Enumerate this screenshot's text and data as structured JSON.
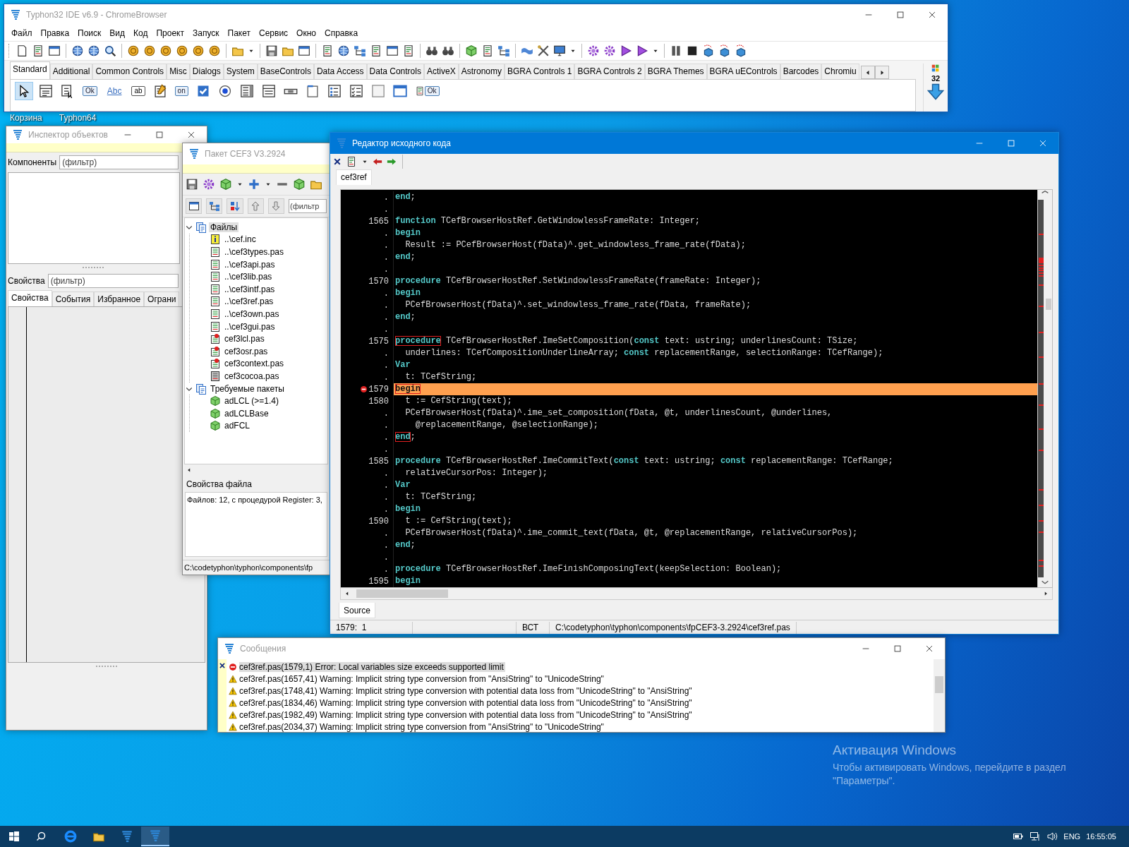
{
  "desktop": {
    "icons": [
      {
        "label": "Корзина"
      },
      {
        "label": "Typhon64"
      }
    ],
    "activation": {
      "title": "Активация Windows",
      "text": "Чтобы активировать Windows, перейдите в раздел \"Параметры\"."
    }
  },
  "main_window": {
    "title": "Typhon32 IDE v6.9 - ChromeBrowser",
    "menu": [
      "Файл",
      "Правка",
      "Поиск",
      "Вид",
      "Код",
      "Проект",
      "Запуск",
      "Пакет",
      "Сервис",
      "Окно",
      "Справка"
    ],
    "palette_tabs": [
      {
        "label": "Standard",
        "selected": true
      },
      {
        "label": "Additional",
        "selected": false
      },
      {
        "label": "Common Controls",
        "selected": false
      },
      {
        "label": "Misc",
        "selected": false
      },
      {
        "label": "Dialogs",
        "selected": false
      },
      {
        "label": "System",
        "selected": false
      },
      {
        "label": "BaseControls",
        "selected": false
      },
      {
        "label": "Data Access",
        "selected": false
      },
      {
        "label": "Data Controls",
        "selected": false
      },
      {
        "label": "ActiveX",
        "selected": false
      },
      {
        "label": "Astronomy",
        "selected": false
      },
      {
        "label": "BGRA Controls 1",
        "selected": false
      },
      {
        "label": "BGRA Controls 2",
        "selected": false
      },
      {
        "label": "BGRA Themes",
        "selected": false
      },
      {
        "label": "BGRA uEControls",
        "selected": false
      },
      {
        "label": "Barcodes",
        "selected": false
      },
      {
        "label": "Chromiu",
        "selected": false
      }
    ],
    "palette": [
      {
        "kind": "pointer",
        "selected": true
      },
      {
        "kind": "menu",
        "selected": false
      },
      {
        "kind": "popup",
        "selected": false
      },
      {
        "kind": "button",
        "label": "Ok",
        "selected": false
      },
      {
        "kind": "label",
        "label": "Abc",
        "selected": false
      },
      {
        "kind": "edit",
        "label": "ab",
        "selected": false
      },
      {
        "kind": "memo",
        "selected": false
      },
      {
        "kind": "toggle",
        "label": "on",
        "selected": false
      },
      {
        "kind": "checkbox",
        "selected": false
      },
      {
        "kind": "radio",
        "selected": false
      },
      {
        "kind": "listbox",
        "selected": false
      },
      {
        "kind": "combo",
        "selected": false
      },
      {
        "kind": "scrollbar",
        "selected": false
      },
      {
        "kind": "groupbox",
        "selected": false
      },
      {
        "kind": "radiogroup",
        "selected": false
      },
      {
        "kind": "checkgroup",
        "selected": false
      },
      {
        "kind": "panel",
        "selected": false
      },
      {
        "kind": "frame",
        "selected": false
      },
      {
        "kind": "actionlist",
        "label": "Ok",
        "selected": false
      }
    ],
    "palette_size": "32"
  },
  "inspector": {
    "title": "Инспектор объектов",
    "components_label": "Компоненты",
    "components_filter": {
      "placeholder": "(фильтр)"
    },
    "properties_label": "Свойства",
    "properties_filter": {
      "placeholder": "(фильтр)"
    },
    "tabs": [
      {
        "label": "Свойства",
        "selected": true
      },
      {
        "label": "События",
        "selected": false
      },
      {
        "label": "Избранное",
        "selected": false
      },
      {
        "label": "Ограни",
        "selected": false
      }
    ]
  },
  "package": {
    "title": "Пакет CEF3 V3.2924",
    "filter": {
      "placeholder": "(фильтр"
    },
    "tree": [
      {
        "label": "Файлы",
        "kind": "folder",
        "expanded": true,
        "selected": true,
        "children": [
          {
            "label": "..\\cef.inc",
            "kind": "include",
            "selected": false
          },
          {
            "label": "..\\cef3types.pas",
            "kind": "unit",
            "selected": false
          },
          {
            "label": "..\\cef3api.pas",
            "kind": "unit",
            "selected": false
          },
          {
            "label": "..\\cef3lib.pas",
            "kind": "unit",
            "selected": false
          },
          {
            "label": "..\\cef3intf.pas",
            "kind": "unit",
            "selected": false
          },
          {
            "label": "..\\cef3ref.pas",
            "kind": "unit",
            "selected": false
          },
          {
            "label": "..\\cef3own.pas",
            "kind": "unit",
            "selected": false
          },
          {
            "label": "..\\cef3gui.pas",
            "kind": "unit",
            "selected": false
          },
          {
            "label": "cef3lcl.pas",
            "kind": "register",
            "selected": false
          },
          {
            "label": "cef3osr.pas",
            "kind": "register",
            "selected": false
          },
          {
            "label": "cef3context.pas",
            "kind": "register",
            "selected": false
          },
          {
            "label": "cef3cocoa.pas",
            "kind": "other",
            "selected": false
          }
        ]
      },
      {
        "label": "Требуемые пакеты",
        "kind": "folder",
        "expanded": true,
        "selected": false,
        "children": [
          {
            "label": "adLCL (>=1.4)",
            "kind": "package",
            "selected": false
          },
          {
            "label": "adLCLBase",
            "kind": "package",
            "selected": false
          },
          {
            "label": "adFCL",
            "kind": "package",
            "selected": false
          }
        ]
      }
    ],
    "file_properties": {
      "title": "Свойства файла",
      "text": "Файлов: 12, с процедурой Register: 3,"
    },
    "status": "C:\\codetyphon\\typhon\\components\\fp"
  },
  "editor": {
    "title": "Редактор исходного кода",
    "tabs": [
      {
        "label": "cef3ref",
        "selected": true
      }
    ],
    "lines": [
      {
        "gutter": ".",
        "current": false,
        "error": false,
        "segments": [
          {
            "kind": "keyword",
            "text": "end"
          },
          {
            "kind": "plain",
            "text": ";"
          }
        ]
      },
      {
        "gutter": ".",
        "current": false,
        "error": false
      },
      {
        "gutter": "1565",
        "current": false,
        "error": false,
        "segments": [
          {
            "kind": "keyword",
            "text": "function"
          },
          {
            "kind": "plain",
            "text": " TCefBrowserHostRef.GetWindowlessFrameRate: Integer;"
          }
        ]
      },
      {
        "gutter": ".",
        "current": false,
        "error": false,
        "segments": [
          {
            "kind": "keyword",
            "text": "begin"
          }
        ]
      },
      {
        "gutter": ".",
        "current": false,
        "error": false,
        "segments": [
          {
            "kind": "plain",
            "text": "  Result := PCefBrowserHost(fData)^.get_windowless_frame_rate(fData);"
          }
        ]
      },
      {
        "gutter": ".",
        "current": false,
        "error": false,
        "segments": [
          {
            "kind": "keyword",
            "text": "end"
          },
          {
            "kind": "plain",
            "text": ";"
          }
        ]
      },
      {
        "gutter": ".",
        "current": false,
        "error": false
      },
      {
        "gutter": "1570",
        "current": false,
        "error": false,
        "segments": [
          {
            "kind": "keyword",
            "text": "procedure"
          },
          {
            "kind": "plain",
            "text": " TCefBrowserHostRef.SetWindowlessFrameRate(frameRate: Integer);"
          }
        ]
      },
      {
        "gutter": ".",
        "current": false,
        "error": false,
        "segments": [
          {
            "kind": "keyword",
            "text": "begin"
          }
        ]
      },
      {
        "gutter": ".",
        "current": false,
        "error": false,
        "segments": [
          {
            "kind": "plain",
            "text": "  PCefBrowserHost(fData)^.set_windowless_frame_rate(fData, frameRate);"
          }
        ]
      },
      {
        "gutter": ".",
        "current": false,
        "error": false,
        "segments": [
          {
            "kind": "keyword",
            "text": "end"
          },
          {
            "kind": "plain",
            "text": ";"
          }
        ]
      },
      {
        "gutter": ".",
        "current": false,
        "error": false
      },
      {
        "gutter": "1575",
        "current": false,
        "error": false,
        "segments": [
          {
            "kind": "boxed",
            "text": "procedure"
          },
          {
            "kind": "plain",
            "text": " TCefBrowserHostRef.ImeSetComposition("
          },
          {
            "kind": "keyword",
            "text": "const"
          },
          {
            "kind": "plain",
            "text": " text: ustring; underlinesCount: TSize;"
          }
        ]
      },
      {
        "gutter": ".",
        "current": false,
        "error": false,
        "segments": [
          {
            "kind": "plain",
            "text": "  underlines: TCefCompositionUnderlineArray; "
          },
          {
            "kind": "keyword",
            "text": "const"
          },
          {
            "kind": "plain",
            "text": " replacementRange, selectionRange: TCefRange);"
          }
        ]
      },
      {
        "gutter": ".",
        "current": false,
        "error": false,
        "segments": [
          {
            "kind": "keyword",
            "text": "Var"
          }
        ]
      },
      {
        "gutter": ".",
        "current": false,
        "error": false,
        "segments": [
          {
            "kind": "plain",
            "text": "  t: TCefString;"
          }
        ]
      },
      {
        "gutter": "1579",
        "current": true,
        "error": true,
        "segments": [
          {
            "kind": "boxed",
            "text": "begin"
          }
        ]
      },
      {
        "gutter": "1580",
        "current": false,
        "error": false,
        "segments": [
          {
            "kind": "plain",
            "text": "  t := CefString(text);"
          }
        ]
      },
      {
        "gutter": ".",
        "current": false,
        "error": false,
        "segments": [
          {
            "kind": "plain",
            "text": "  PCefBrowserHost(fData)^.ime_set_composition(fData, @t, underlinesCount, @underlines,"
          }
        ]
      },
      {
        "gutter": ".",
        "current": false,
        "error": false,
        "segments": [
          {
            "kind": "plain",
            "text": "    @replacementRange, @selectionRange);"
          }
        ]
      },
      {
        "gutter": ".",
        "current": false,
        "error": false,
        "segments": [
          {
            "kind": "boxed",
            "text": "end"
          },
          {
            "kind": "plain",
            "text": ";"
          }
        ]
      },
      {
        "gutter": ".",
        "current": false,
        "error": false
      },
      {
        "gutter": "1585",
        "current": false,
        "error": false,
        "segments": [
          {
            "kind": "keyword",
            "text": "procedure"
          },
          {
            "kind": "plain",
            "text": " TCefBrowserHostRef.ImeCommitText("
          },
          {
            "kind": "keyword",
            "text": "const"
          },
          {
            "kind": "plain",
            "text": " text: ustring; "
          },
          {
            "kind": "keyword",
            "text": "const"
          },
          {
            "kind": "plain",
            "text": " replacementRange: TCefRange;"
          }
        ]
      },
      {
        "gutter": ".",
        "current": false,
        "error": false,
        "segments": [
          {
            "kind": "plain",
            "text": "  relativeCursorPos: Integer);"
          }
        ]
      },
      {
        "gutter": ".",
        "current": false,
        "error": false,
        "segments": [
          {
            "kind": "keyword",
            "text": "Var"
          }
        ]
      },
      {
        "gutter": ".",
        "current": false,
        "error": false,
        "segments": [
          {
            "kind": "plain",
            "text": "  t: TCefString;"
          }
        ]
      },
      {
        "gutter": ".",
        "current": false,
        "error": false,
        "segments": [
          {
            "kind": "keyword",
            "text": "begin"
          }
        ]
      },
      {
        "gutter": "1590",
        "current": false,
        "error": false,
        "segments": [
          {
            "kind": "plain",
            "text": "  t := CefString(text);"
          }
        ]
      },
      {
        "gutter": ".",
        "current": false,
        "error": false,
        "segments": [
          {
            "kind": "plain",
            "text": "  PCefBrowserHost(fData)^.ime_commit_text(fData, @t, @replacementRange, relativeCursorPos);"
          }
        ]
      },
      {
        "gutter": ".",
        "current": false,
        "error": false,
        "segments": [
          {
            "kind": "keyword",
            "text": "end"
          },
          {
            "kind": "plain",
            "text": ";"
          }
        ]
      },
      {
        "gutter": ".",
        "current": false,
        "error": false
      },
      {
        "gutter": ".",
        "current": false,
        "error": false,
        "segments": [
          {
            "kind": "keyword",
            "text": "procedure"
          },
          {
            "kind": "plain",
            "text": " TCefBrowserHostRef.ImeFinishComposingText(keepSelection: Boolean);"
          }
        ]
      },
      {
        "gutter": "1595",
        "current": false,
        "error": false,
        "segments": [
          {
            "kind": "keyword",
            "text": "begin"
          }
        ]
      }
    ],
    "bottom_tabs": [
      {
        "label": "Source",
        "selected": true
      }
    ],
    "status": {
      "position": "1579:  1",
      "mode": "ВСТ",
      "path": "C:\\codetyphon\\typhon\\components\\fpCEF3-3.2924\\cef3ref.pas"
    }
  },
  "messages": {
    "title": "Сообщения",
    "items": [
      {
        "kind": "error",
        "text": "cef3ref.pas(1579,1) Error: Local variables size exceeds supported limit",
        "selected": true
      },
      {
        "kind": "warning",
        "text": "cef3ref.pas(1657,41) Warning: Implicit string type conversion from \"AnsiString\" to \"UnicodeString\"",
        "selected": false
      },
      {
        "kind": "warning",
        "text": "cef3ref.pas(1748,41) Warning: Implicit string type conversion with potential data loss from \"UnicodeString\" to \"AnsiString\"",
        "selected": false
      },
      {
        "kind": "warning",
        "text": "cef3ref.pas(1834,46) Warning: Implicit string type conversion with potential data loss from \"UnicodeString\" to \"AnsiString\"",
        "selected": false
      },
      {
        "kind": "warning",
        "text": "cef3ref.pas(1982,49) Warning: Implicit string type conversion with potential data loss from \"UnicodeString\" to \"AnsiString\"",
        "selected": false
      },
      {
        "kind": "warning",
        "text": "cef3ref.pas(2034,37) Warning: Implicit string type conversion from \"AnsiString\" to \"UnicodeString\"",
        "selected": false
      }
    ]
  },
  "taskbar": {
    "apps": [
      {
        "kind": "browser",
        "active": false
      },
      {
        "kind": "folder",
        "active": false
      },
      {
        "kind": "typhon",
        "active": false
      },
      {
        "kind": "typhon",
        "active": true
      }
    ],
    "language": "ENG",
    "time": "16:55:05"
  }
}
